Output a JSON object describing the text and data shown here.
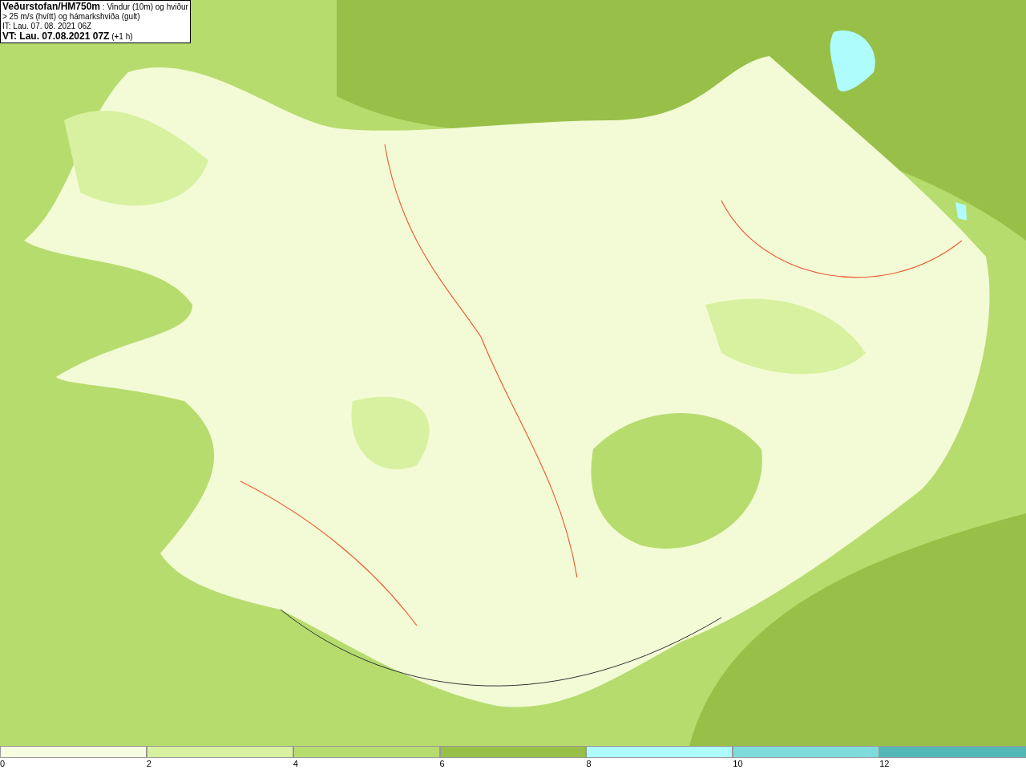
{
  "header": {
    "description": "**Veðurstofan/HM750m** : Vindur (10m) og hviður > 25 m/s (hvítt) og hámarkshviða (gult)",
    "issue_time": "IT: Lau. 07. 08. 2021 06Z",
    "valid_time": "**VT: Lau. 07.08.2021 07Z** (+1 h)"
  },
  "legend": {
    "bins": [
      {
        "color": "#f7fde0"
      },
      {
        "color": "#d8f1a0"
      },
      {
        "color": "#b6dc6e"
      },
      {
        "color": "#98c048"
      },
      {
        "color": "#aefcfc"
      },
      {
        "color": "#7fdcdc"
      },
      {
        "color": "#55b8b8"
      }
    ],
    "ticks": [
      "0",
      "2",
      "4",
      "6",
      "8",
      "10",
      "12"
    ]
  }
}
